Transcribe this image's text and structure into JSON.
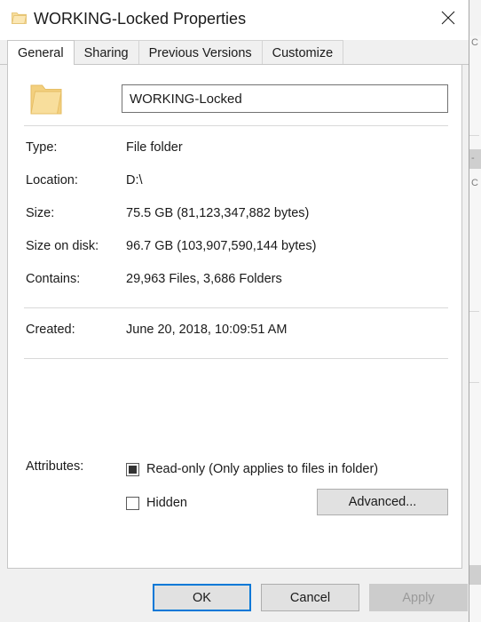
{
  "window": {
    "title": "WORKING-Locked Properties",
    "title_icon": "folder-icon",
    "close_label": "✕"
  },
  "tabs": [
    {
      "label": "General",
      "active": true
    },
    {
      "label": "Sharing",
      "active": false
    },
    {
      "label": "Previous Versions",
      "active": false
    },
    {
      "label": "Customize",
      "active": false
    }
  ],
  "general": {
    "folder_icon": "folder-icon",
    "name_value": "WORKING-Locked",
    "name_placeholder": "",
    "properties": [
      {
        "label": "Type:",
        "value": "File folder"
      },
      {
        "label": "Location:",
        "value": "D:\\"
      },
      {
        "label": "Size:",
        "value": "75.5 GB (81,123,347,882 bytes)"
      },
      {
        "label": "Size on disk:",
        "value": "96.7 GB (103,907,590,144 bytes)"
      },
      {
        "label": "Contains:",
        "value": "29,963 Files, 3,686 Folders"
      }
    ],
    "created": {
      "label": "Created:",
      "value": "June 20, 2018, 10:09:51 AM"
    },
    "attributes": {
      "label": "Attributes:",
      "readonly": {
        "label": "Read-only (Only applies to files in folder)",
        "state": "indeterminate"
      },
      "hidden": {
        "label": "Hidden",
        "state": "unchecked"
      },
      "advanced_label": "Advanced..."
    }
  },
  "footer": {
    "ok_label": "OK",
    "cancel_label": "Cancel",
    "apply_label": "Apply",
    "apply_enabled": false
  },
  "colors": {
    "accent": "#0078d7",
    "folder": "#f5d98f",
    "dialog_bg": "#f0f0f0",
    "page_bg": "#ffffff"
  }
}
